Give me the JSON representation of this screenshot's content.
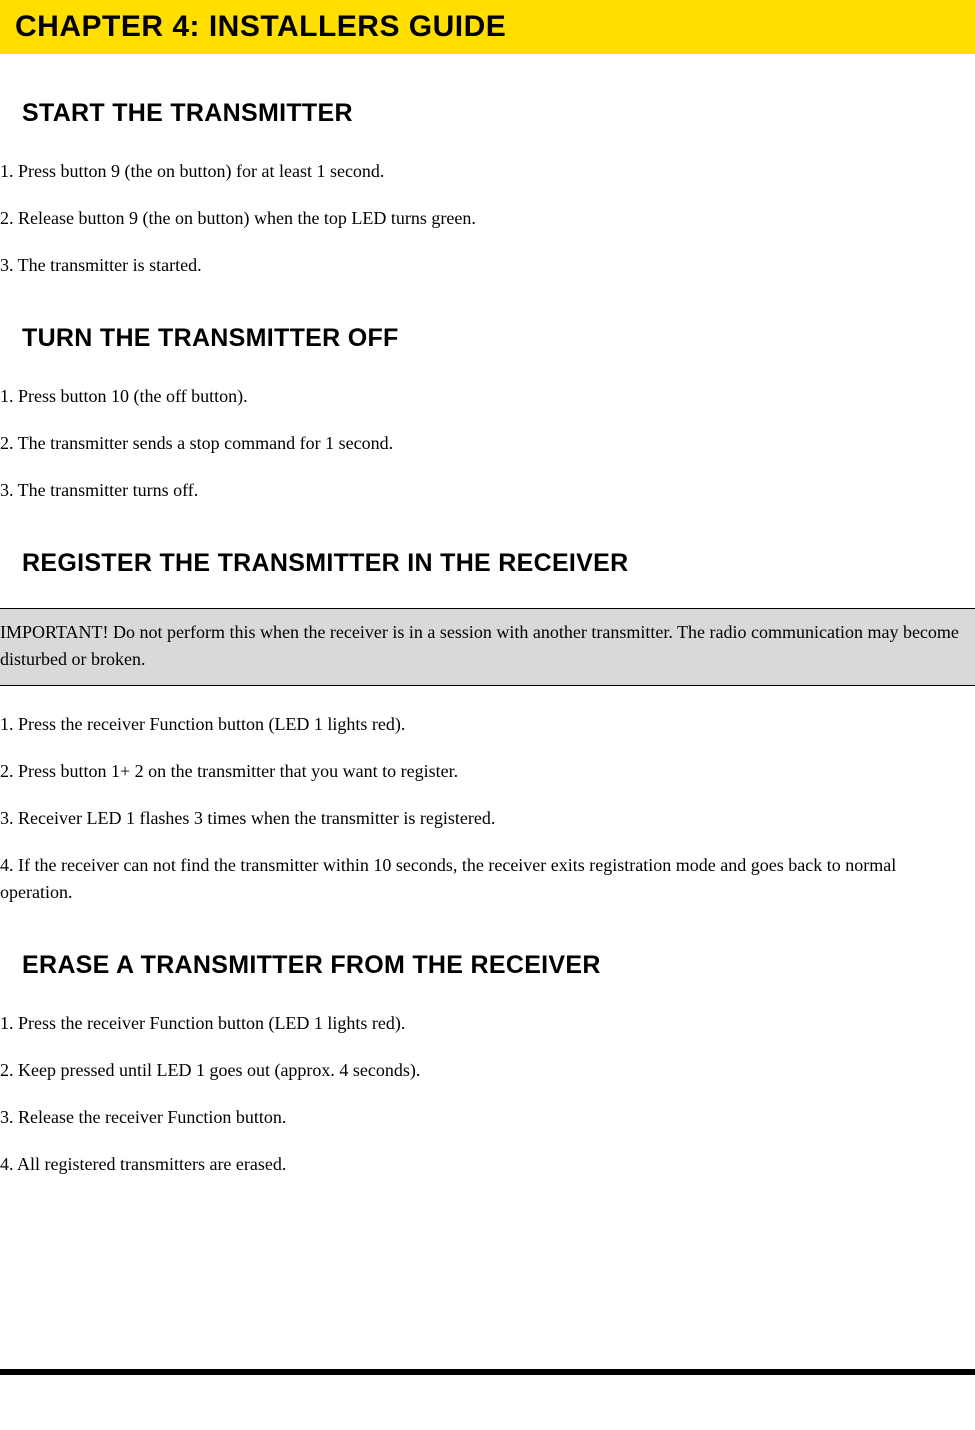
{
  "chapter": {
    "title": "CHAPTER 4: INSTALLERS GUIDE"
  },
  "sections": {
    "start_transmitter": {
      "heading": "START THE TRANSMITTER",
      "steps": [
        "1. Press button 9 (the on button) for at least 1 second.",
        "2. Release button 9 (the on button) when the top LED turns green.",
        "3. The transmitter is started."
      ]
    },
    "turn_off": {
      "heading": "TURN THE TRANSMITTER OFF",
      "steps": [
        "1. Press button 10 (the off button).",
        "2. The transmitter sends a stop command for 1 second.",
        "3. The transmitter turns off."
      ]
    },
    "register": {
      "heading": "REGISTER THE TRANSMITTER IN THE RECEIVER",
      "important": "IMPORTANT! Do not perform this when the receiver is in a session with another transmitter. The radio communication may become disturbed or broken.",
      "steps": [
        "1. Press the receiver Function button (LED 1 lights red).",
        "2. Press button 1+ 2 on the transmitter that you want to register.",
        "3. Receiver LED 1 flashes 3 times when the transmitter is registered.",
        "4. If the receiver can not find the transmitter within 10 seconds, the receiver exits registration mode and goes back to normal operation."
      ]
    },
    "erase": {
      "heading": "ERASE A TRANSMITTER FROM THE RECEIVER",
      "steps": [
        "1. Press the receiver Function button (LED 1 lights red).",
        "2. Keep pressed until LED 1 goes out (approx. 4 seconds).",
        "3. Release the receiver Function button.",
        "4. All registered transmitters are erased."
      ]
    }
  }
}
